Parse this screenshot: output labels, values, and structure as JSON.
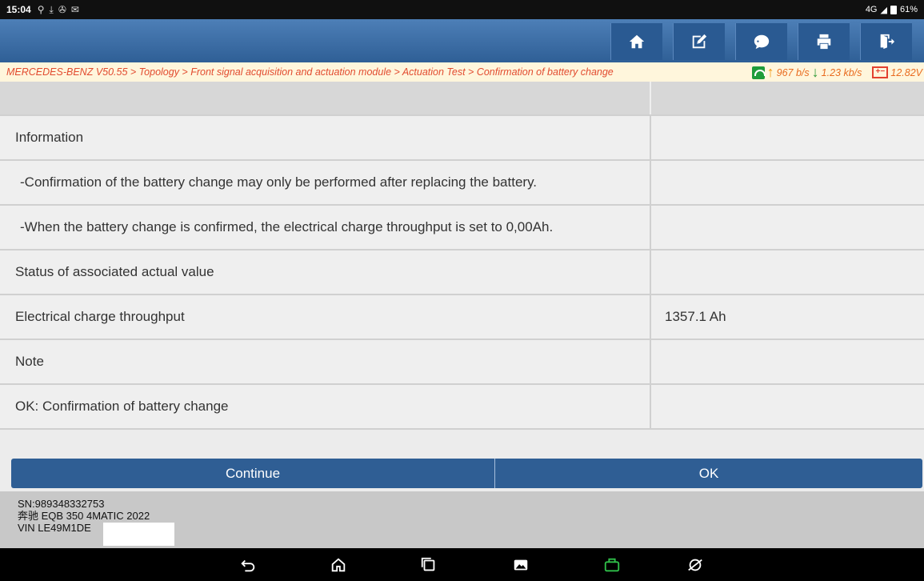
{
  "status_bar": {
    "time": "15:04",
    "left_icons": [
      "usb-icon",
      "download-icon",
      "accessibility-icon",
      "message-icon"
    ],
    "network": "4G",
    "battery": "61%"
  },
  "toolbar": {
    "buttons": [
      "home-icon",
      "edit-report-icon",
      "chat-icon",
      "print-icon",
      "exit-icon"
    ]
  },
  "breadcrumb": {
    "path": "MERCEDES-BENZ V50.55 > Topology > Front signal acquisition and actuation module > Actuation Test > Confirmation of battery change",
    "upload_speed": "967 b/s",
    "download_speed": "1.23 kb/s",
    "voltage": "12.82V"
  },
  "table": {
    "rows": [
      {
        "label": "Information",
        "value": ""
      },
      {
        "label": " -Confirmation of the battery change may only be performed after replacing the battery.",
        "value": ""
      },
      {
        "label": " -When the battery change is confirmed, the electrical charge throughput is set to 0,00Ah.",
        "value": ""
      },
      {
        "label": "Status of associated actual value",
        "value": ""
      },
      {
        "label": "Electrical charge throughput",
        "value": "1357.1 Ah"
      },
      {
        "label": "Note",
        "value": ""
      },
      {
        "label": "OK: Confirmation of battery change",
        "value": ""
      }
    ]
  },
  "actions": {
    "continue_label": "Continue",
    "ok_label": "OK"
  },
  "vehicle_info": {
    "sn": "SN:989348332753",
    "model": "奔驰 EQB 350 4MATIC 2022",
    "vin": "VIN LE49M1DE"
  },
  "colors": {
    "toolbar": "#2f5f96",
    "button": "#2f5e94",
    "breadcrumb_text": "#e24b2f",
    "row_bg": "#efefef"
  }
}
